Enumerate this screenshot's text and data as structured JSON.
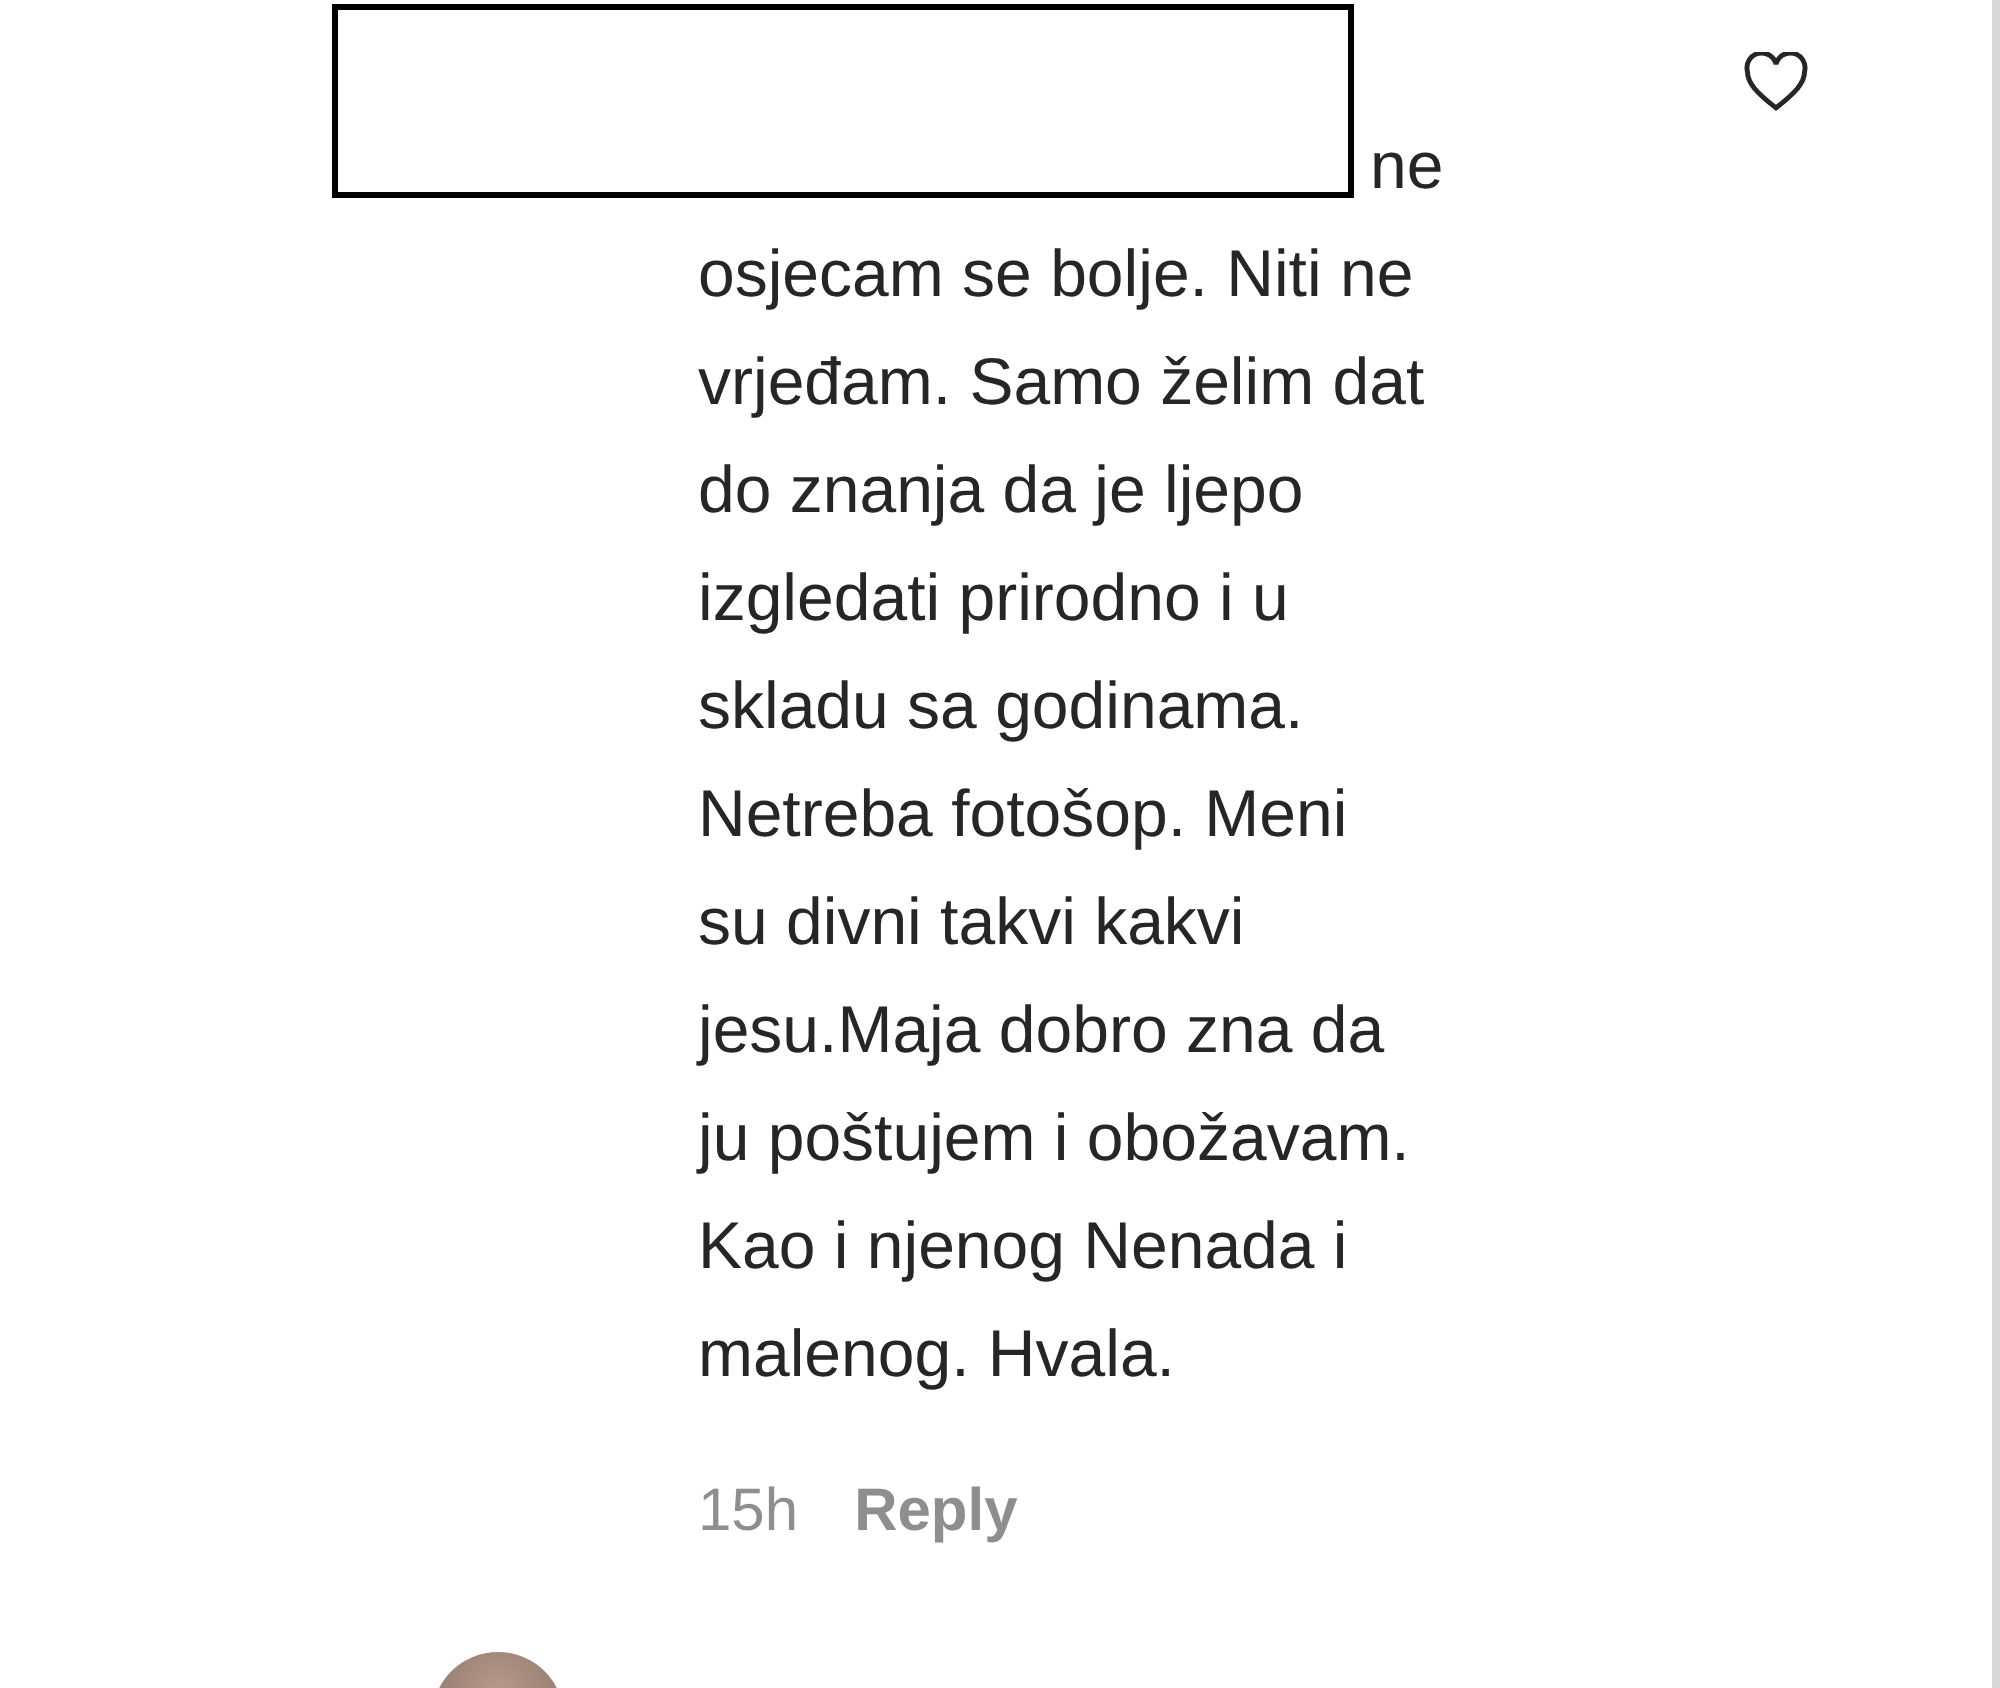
{
  "comment": {
    "lines": [
      "ne",
      "osjecam se bolje. Niti ne",
      "vrjeđam. Samo želim dat",
      "do znanja da je ljepo",
      "izgledati prirodno i u",
      "skladu sa godinama.",
      "Netreba fotošop. Meni",
      "su divni takvi kakvi",
      "jesu.Maja dobro zna da",
      "ju poštujem i obožavam.",
      "Kao i njenog Nenada i",
      "malenog. Hvala."
    ],
    "time": "15h",
    "reply": "Reply",
    "liked": false
  }
}
